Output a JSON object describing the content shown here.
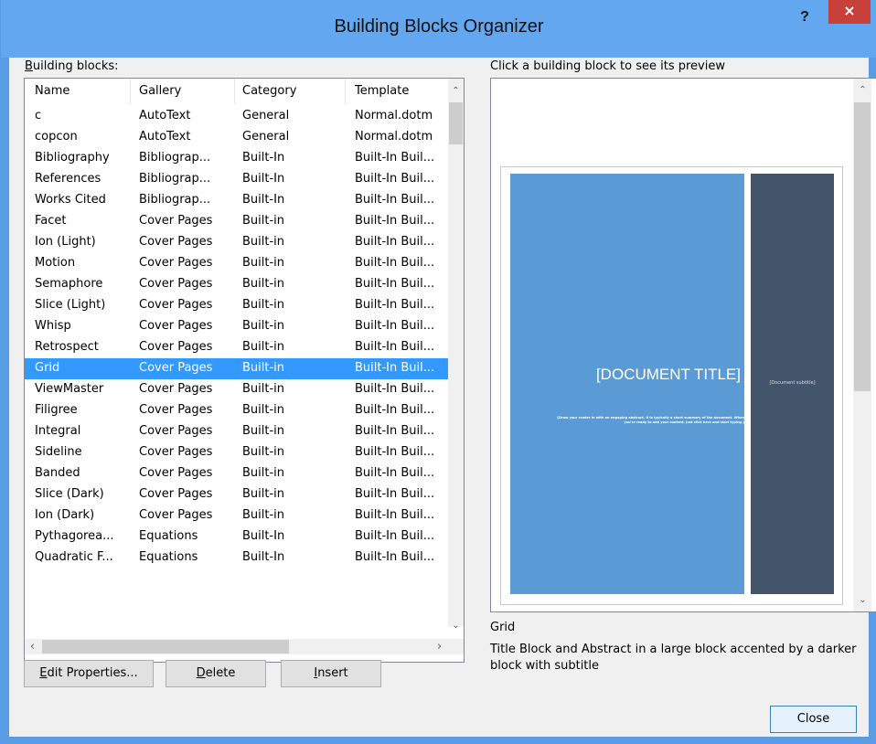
{
  "window": {
    "title": "Building Blocks Organizer",
    "help": "?",
    "close_glyph": "×"
  },
  "labels": {
    "building_blocks": "Building blocks:",
    "preview_hint": "Click a building block to see its preview"
  },
  "columns": [
    "Name",
    "Gallery",
    "Category",
    "Template"
  ],
  "rows": [
    [
      "c",
      "AutoText",
      "General",
      "Normal.dotm"
    ],
    [
      "copcon",
      "AutoText",
      "General",
      "Normal.dotm"
    ],
    [
      "Bibliography",
      "Bibliograp...",
      "Built-In",
      "Built-In Buil..."
    ],
    [
      "References",
      "Bibliograp...",
      "Built-In",
      "Built-In Buil..."
    ],
    [
      "Works Cited",
      "Bibliograp...",
      "Built-In",
      "Built-In Buil..."
    ],
    [
      "Facet",
      "Cover Pages",
      "Built-in",
      "Built-In Buil..."
    ],
    [
      "Ion (Light)",
      "Cover Pages",
      "Built-in",
      "Built-In Buil..."
    ],
    [
      "Motion",
      "Cover Pages",
      "Built-in",
      "Built-In Buil..."
    ],
    [
      "Semaphore",
      "Cover Pages",
      "Built-in",
      "Built-In Buil..."
    ],
    [
      "Slice (Light)",
      "Cover Pages",
      "Built-in",
      "Built-In Buil..."
    ],
    [
      "Whisp",
      "Cover Pages",
      "Built-in",
      "Built-In Buil..."
    ],
    [
      "Retrospect",
      "Cover Pages",
      "Built-in",
      "Built-In Buil..."
    ],
    [
      "Grid",
      "Cover Pages",
      "Built-in",
      "Built-In Buil..."
    ],
    [
      "ViewMaster",
      "Cover Pages",
      "Built-in",
      "Built-In Buil..."
    ],
    [
      "Filigree",
      "Cover Pages",
      "Built-in",
      "Built-In Buil..."
    ],
    [
      "Integral",
      "Cover Pages",
      "Built-in",
      "Built-In Buil..."
    ],
    [
      "Sideline",
      "Cover Pages",
      "Built-in",
      "Built-In Buil..."
    ],
    [
      "Banded",
      "Cover Pages",
      "Built-in",
      "Built-In Buil..."
    ],
    [
      "Slice (Dark)",
      "Cover Pages",
      "Built-in",
      "Built-In Buil..."
    ],
    [
      "Ion (Dark)",
      "Cover Pages",
      "Built-in",
      "Built-In Buil..."
    ],
    [
      "Pythagorea...",
      "Equations",
      "Built-In",
      "Built-In Buil..."
    ],
    [
      "Quadratic F...",
      "Equations",
      "Built-In",
      "Built-In Buil..."
    ]
  ],
  "selected_index": 12,
  "buttons": {
    "edit_properties": "Edit Properties...",
    "delete": "Delete",
    "insert": "Insert",
    "close": "Close"
  },
  "preview": {
    "doc_title": "[DOCUMENT TITLE]",
    "doc_abstract": "[Draw your reader in with an engaging abstract. It is typically a short summary of the document. When you're ready to add your content, just click here and start typing.]",
    "doc_subtitle": "[Document subtitle]",
    "name": "Grid",
    "description": "Title Block and Abstract in a large block accented by a darker block with subtitle"
  },
  "colors": {
    "titlebar": "#63a7f0",
    "selection": "#3399ff",
    "close_red": "#c7413a",
    "preview_blue": "#5b9bd5",
    "preview_dark": "#44546a"
  }
}
